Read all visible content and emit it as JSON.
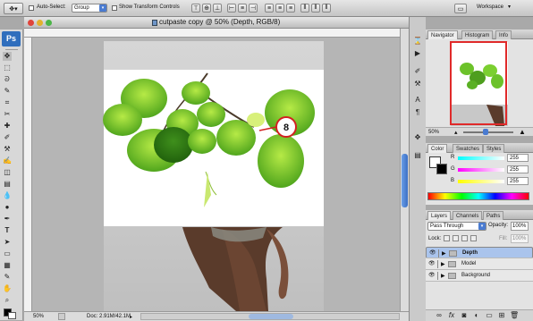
{
  "options_bar": {
    "auto_select_label": "Auto-Select:",
    "auto_select_value": "Group",
    "transform_label": "Show Transform Controls",
    "workspace_label": "Workspace"
  },
  "document": {
    "title": "cutpaste copy @ 50% (Depth, RGB/8)",
    "zoom": "50%",
    "doc_size": "Doc: 2.91M/42.1M",
    "callout_number": "8"
  },
  "tools": {
    "logo": "Ps"
  },
  "navigator": {
    "tabs": [
      "Navigator",
      "Histogram",
      "Info"
    ],
    "zoom": "50%"
  },
  "color_panel": {
    "tabs": [
      "Color",
      "Swatches",
      "Styles"
    ],
    "channels": [
      {
        "label": "R",
        "value": "255"
      },
      {
        "label": "G",
        "value": "255"
      },
      {
        "label": "B",
        "value": "255"
      }
    ],
    "colors": {
      "r_track": "#e33b3b",
      "g_track": "#3cc43c",
      "b_track": "#2e5fe0"
    }
  },
  "layers_panel": {
    "tabs": [
      "Layers",
      "Channels",
      "Paths"
    ],
    "blend_mode": "Pass Through",
    "opacity_label": "Opacity:",
    "opacity_value": "100%",
    "lock_label": "Lock:",
    "fill_label": "Fill:",
    "fill_value": "100%",
    "layers": [
      {
        "name": "Depth",
        "selected": true
      },
      {
        "name": "Model",
        "selected": false
      },
      {
        "name": "Background",
        "selected": false
      }
    ]
  }
}
